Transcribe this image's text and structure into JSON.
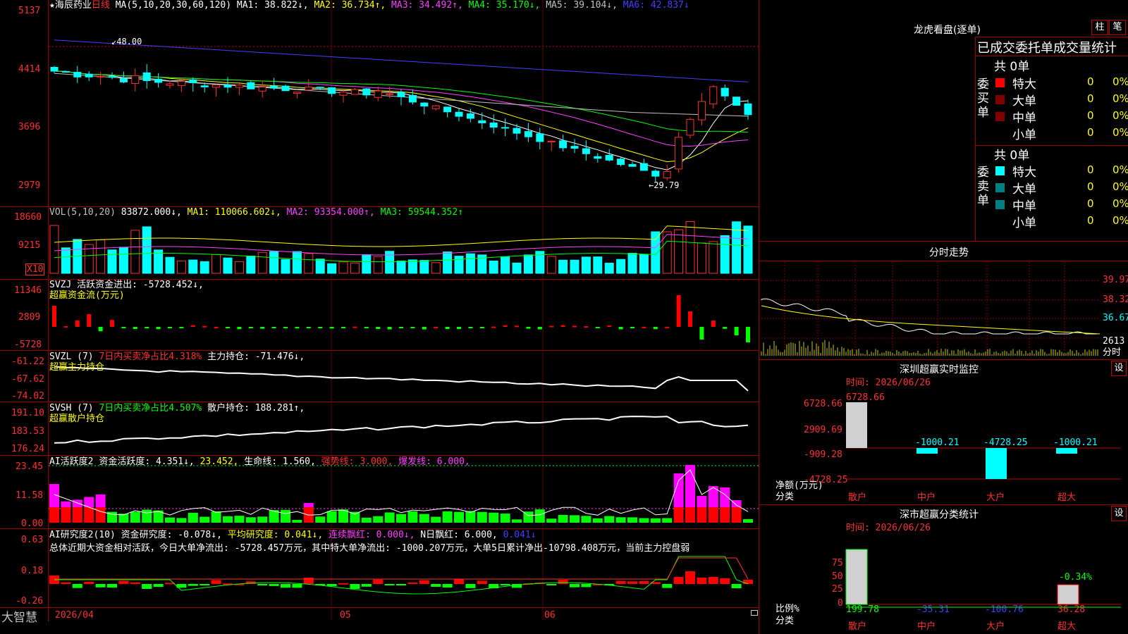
{
  "stock": {
    "star": "★",
    "name": "海辰药业",
    "period": "日线",
    "ma_header": "MA(5,10,20,30,60,120)",
    "ma1": "MA1: 38.822↓,",
    "ma2": "MA2: 36.734↑,",
    "ma3": "MA3: 34.492↑,",
    "ma4": "MA4: 35.170↓,",
    "ma5": "MA5: 39.104↓,",
    "ma6": "MA6: 42.837↓",
    "high_label": "48.00",
    "low_label": "29.79",
    "price_axis": [
      "5137",
      "4414",
      "3696",
      "2979"
    ]
  },
  "vol": {
    "header": "VOL(5,10,20)",
    "value": "83872.000↓,",
    "ma1": "MA1: 110066.602↓,",
    "ma2": "MA2: 93354.000↑,",
    "ma3": "MA3: 59544.352↑",
    "axis": [
      "18660",
      "9215"
    ],
    "unit": "X10"
  },
  "svzj": {
    "header": "SVZJ  活跃资金进出: -5728.452↓,",
    "sub": "超赢资金流(万元)",
    "axis": [
      "11346",
      "2809",
      "-5728"
    ]
  },
  "svzl": {
    "header": "SVZL (7)",
    "ratio": "7日内买卖净占比4.318%",
    "hold": "主力持仓: -71.476↓,",
    "sub": "超赢主力持仓",
    "axis": [
      "-61.22",
      "-67.62",
      "-74.02"
    ]
  },
  "svsh": {
    "header": "SVSH (7)",
    "ratio": "7日内买卖净占比4.507%",
    "hold": "散户持仓: 188.281↑,",
    "sub": "超赢散户持仓",
    "axis": [
      "191.10",
      "183.53",
      "176.24"
    ]
  },
  "ai1": {
    "header": "AI活跃度2",
    "v1": "资金活跃度: 4.351↓,",
    "v2": "23.452,",
    "v3": "生命线: 1.560,",
    "v4": "强势线: 3.000,",
    "v5": "爆发线: 6.000,",
    "axis": [
      "23.45",
      "11.58",
      "0.00"
    ]
  },
  "ai2": {
    "header": "AI研究度2(10)",
    "v1": "资金研究度: -0.078↓,",
    "v2": "平均研究度: 0.041↓,",
    "v3": "连续飘红: 0.000↓,",
    "v4": "N日飘红: 6.000,",
    "v5": "0.041↓",
    "summary": "总体近期大资金相对活跃，今日大单净流出: -5728.457万元，其中特大单净流出: -1000.207万元，大单5日累计净出-10798.408万元，当前主力控盘弱",
    "axis": [
      "0.63",
      "0.18",
      "-0.26"
    ]
  },
  "footer": {
    "brand": "大智慧",
    "dates": [
      "2026/04",
      "05",
      "06"
    ]
  },
  "right": {
    "dragon_title": "龙虎看盘(逐单)",
    "btn_zhu": "柱",
    "btn_bi": "笔",
    "table_title": "已成交委托单成交量统计",
    "buy_total": "共 0单",
    "sell_total": "共 0单",
    "buy_label": "委买单",
    "sell_label": "委卖单",
    "buy_rows": [
      {
        "name": "特大",
        "qty": "0",
        "pct": "0%",
        "color": "#ff0000"
      },
      {
        "name": "大单",
        "qty": "0",
        "pct": "0%",
        "color": "#800000"
      },
      {
        "name": "中单",
        "qty": "0",
        "pct": "0%",
        "color": "#800000"
      },
      {
        "name": "小单",
        "qty": "0",
        "pct": "0%",
        "color": "#000000"
      }
    ],
    "sell_rows": [
      {
        "name": "特大",
        "qty": "0",
        "pct": "0%",
        "color": "#00ffff"
      },
      {
        "name": "大单",
        "qty": "0",
        "pct": "0%",
        "color": "#008080"
      },
      {
        "name": "中单",
        "qty": "0",
        "pct": "0%",
        "color": "#008080"
      },
      {
        "name": "小单",
        "qty": "0",
        "pct": "0%",
        "color": "#000000"
      }
    ],
    "intraday_title": "分时走势",
    "intraday_axis": [
      "39.97",
      "38.32",
      "36.67"
    ],
    "intraday_vol": "2613",
    "intraday_unit": "分时",
    "monitor_title": "深圳超赢实时监控",
    "monitor_btn": "设",
    "monitor_time": "时间: 2026/06/26",
    "monitor_axis": [
      "6728.66",
      "2909.69",
      "-909.28",
      "-4728.25"
    ],
    "monitor_ylabel": "净额(万元)",
    "monitor_xlabel": "分类",
    "monitor_values": [
      "6728.66",
      "-1000.21",
      "-4728.25",
      "-1000.21"
    ],
    "categories": [
      "散户",
      "中户",
      "大户",
      "超大"
    ],
    "stat_title": "深市超赢分类统计",
    "stat_btn": "设",
    "stat_time": "时间: 2026/06/26",
    "stat_axis": [
      "75",
      "50",
      "25",
      "0"
    ],
    "stat_ylabel": "比例%",
    "stat_xlabel": "分类",
    "stat_values": [
      "199.78",
      "-35.31",
      "-100.76",
      "36.28"
    ],
    "stat_top": "-0.34%"
  }
}
